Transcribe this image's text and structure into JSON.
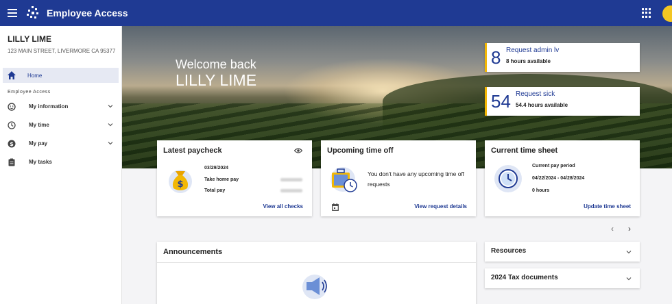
{
  "app": {
    "title": "Employee Access"
  },
  "user": {
    "name": "LILLY LIME",
    "address": "123 MAIN STREET, LIVERMORE CA 95377"
  },
  "sidebar": {
    "home_label": "Home",
    "section_label": "Employee Access",
    "items": [
      {
        "label": "My information",
        "icon": "person-icon",
        "expandable": true
      },
      {
        "label": "My time",
        "icon": "clock-icon",
        "expandable": true
      },
      {
        "label": "My pay",
        "icon": "dollar-icon",
        "expandable": true
      },
      {
        "label": "My tasks",
        "icon": "clipboard-icon",
        "expandable": false
      }
    ]
  },
  "hero": {
    "welcome_line": "Welcome back",
    "name_line": "LILLY LIME"
  },
  "stats": [
    {
      "number": "8",
      "title": "Request admin lv",
      "subtitle": "8 hours available"
    },
    {
      "number": "54",
      "title": "Request sick",
      "subtitle": "54.4 hours available"
    }
  ],
  "paycheck": {
    "title": "Latest paycheck",
    "date": "03/29/2024",
    "take_home_label": "Take home pay",
    "total_label": "Total pay",
    "link": "View all checks"
  },
  "time_off": {
    "title": "Upcoming time off",
    "message": "You don't have any upcoming time off requests",
    "link": "View request details"
  },
  "timesheet": {
    "title": "Current time sheet",
    "period_label": "Current pay period",
    "period": "04/22/2024 - 04/28/2024",
    "hours": "0 hours",
    "link": "Update time sheet"
  },
  "announcements": {
    "title": "Announcements"
  },
  "resources": [
    {
      "title": "Resources"
    },
    {
      "title": "2024 Tax documents"
    }
  ],
  "colors": {
    "primary": "#1f3a93",
    "accent": "#f2b705",
    "avatar": "#f3c623"
  }
}
